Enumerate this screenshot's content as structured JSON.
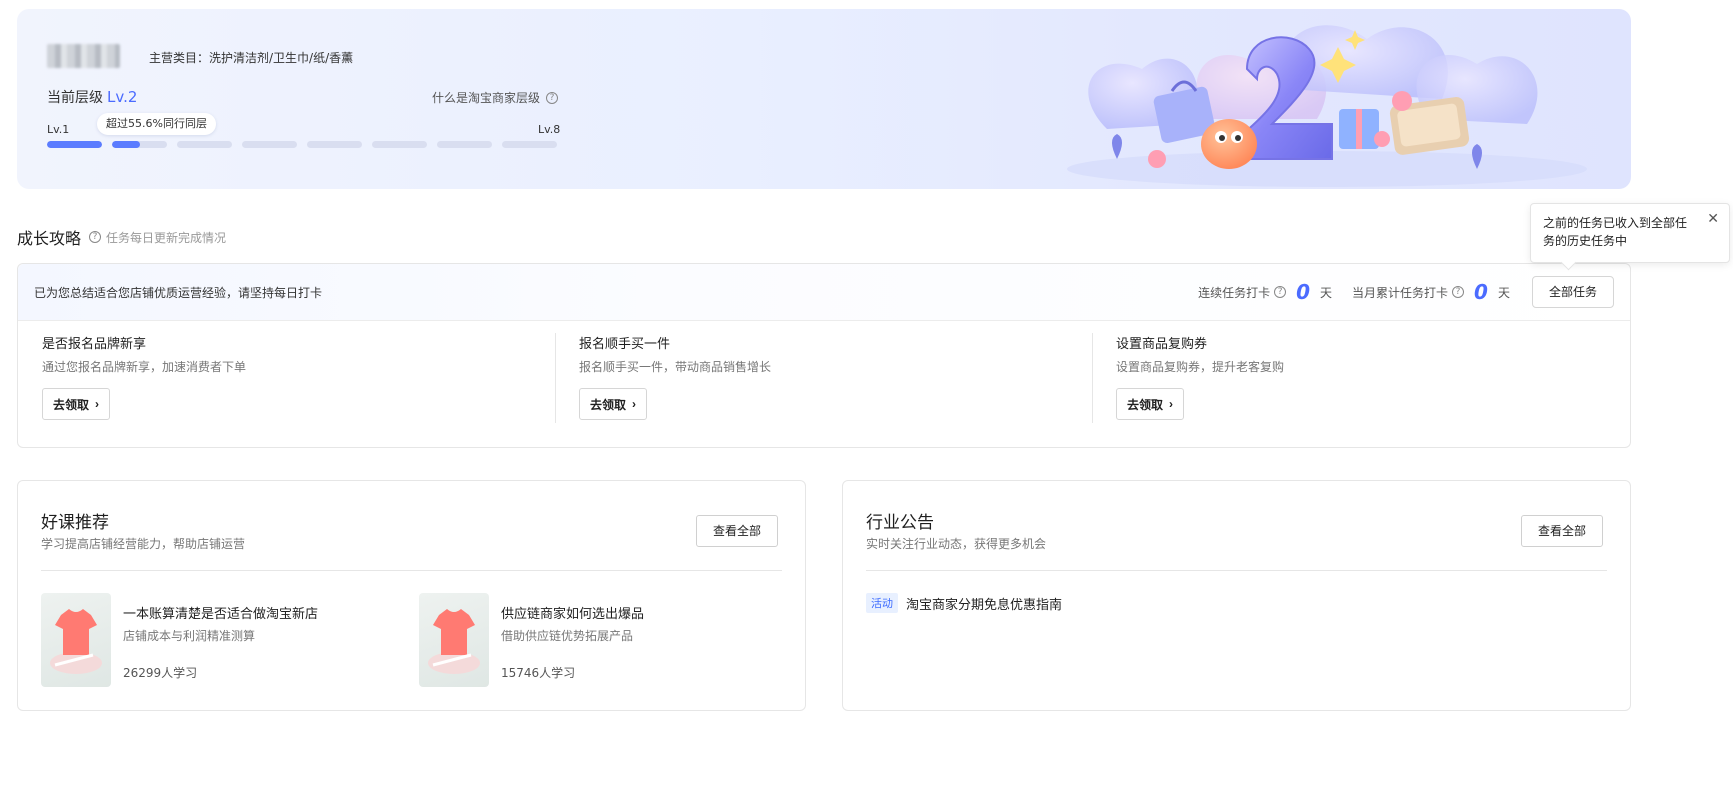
{
  "banner": {
    "category": "主营类目：洗护清洁剂/卫生巾/纸/香薰",
    "level_prefix": "当前层级",
    "level_value": "Lv.2",
    "what_link": "什么是淘宝商家层级",
    "lv_min": "Lv.1",
    "lv_max": "Lv.8",
    "progress_chip": "超过55.6%同行同层",
    "segments": [
      1,
      0.5,
      0,
      0,
      0,
      0,
      0,
      0
    ]
  },
  "growth": {
    "title": "成长攻略",
    "subtitle": "任务每日更新完成情况",
    "intro": "已为您总结适合您店铺优质运营经验，请坚持每日打卡",
    "consecutive_label": "连续任务打卡",
    "consecutive_value": "0",
    "monthly_label": "当月累计任务打卡",
    "monthly_value": "0",
    "day_unit": "天",
    "all_tasks_button": "全部任务",
    "go_button": "去领取",
    "tasks": [
      {
        "title": "是否报名品牌新享",
        "desc": "通过您报名品牌新享，加速消费者下单"
      },
      {
        "title": "报名顺手买一件",
        "desc": "报名顺手买一件，带动商品销售增长"
      },
      {
        "title": "设置商品复购券",
        "desc": "设置商品复购券，提升老客复购"
      }
    ]
  },
  "popover": {
    "text": "之前的任务已收入到全部任务的历史任务中",
    "close": "✕"
  },
  "courses": {
    "title": "好课推荐",
    "subtitle": "学习提高店铺经营能力，帮助店铺运营",
    "view_all": "查看全部",
    "items": [
      {
        "title": "一本账算清楚是否适合做淘宝新店",
        "desc": "店铺成本与利润精准测算",
        "count": "26299人学习"
      },
      {
        "title": "供应链商家如何选出爆品",
        "desc": "借助供应链优势拓展产品",
        "count": "15746人学习"
      }
    ]
  },
  "industry": {
    "title": "行业公告",
    "subtitle": "实时关注行业动态，获得更多机会",
    "view_all": "查看全部",
    "notices": [
      {
        "tag": "活动",
        "text": "淘宝商家分期免息优惠指南"
      }
    ]
  }
}
